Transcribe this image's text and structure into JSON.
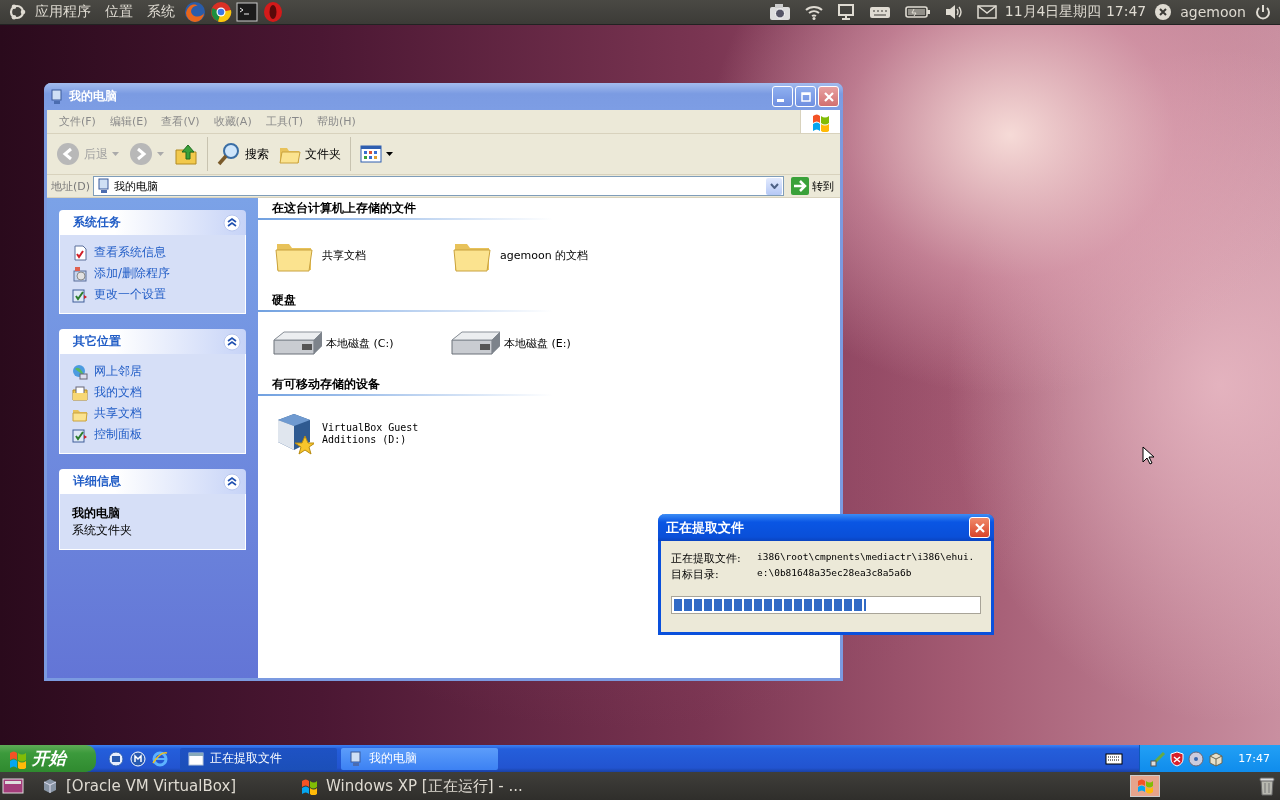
{
  "top_panel": {
    "menus": [
      "应用程序",
      "位置",
      "系统"
    ],
    "clock": "11月4日星期四 17:47",
    "user": "agemoon"
  },
  "explorer": {
    "title": "我的电脑",
    "menu": [
      "文件(F)",
      "编辑(E)",
      "查看(V)",
      "收藏(A)",
      "工具(T)",
      "帮助(H)"
    ],
    "toolbar": [
      {
        "kind": "back",
        "label": "后退",
        "disabled": true
      },
      {
        "kind": "forward",
        "disabled": true
      },
      {
        "kind": "up"
      },
      {
        "kind": "search",
        "label": "搜索"
      },
      {
        "kind": "folders",
        "label": "文件夹"
      },
      {
        "kind": "views"
      }
    ],
    "address": {
      "label": "地址(D)",
      "value": "我的电脑",
      "go": "转到"
    },
    "sidebar": [
      {
        "title": "系统任务",
        "expanded": true,
        "items": [
          {
            "kind": "info",
            "label": "查看系统信息"
          },
          {
            "kind": "programs",
            "label": "添加/删除程序"
          },
          {
            "kind": "settings",
            "label": "更改一个设置"
          }
        ]
      },
      {
        "title": "其它位置",
        "expanded": true,
        "items": [
          {
            "kind": "network",
            "label": "网上邻居"
          },
          {
            "kind": "documents",
            "label": "我的文档"
          },
          {
            "kind": "folder",
            "label": "共享文档"
          },
          {
            "kind": "settings",
            "label": "控制面板"
          }
        ]
      },
      {
        "title": "详细信息",
        "expanded": true,
        "details": {
          "name": "我的电脑",
          "description": "系统文件夹"
        }
      }
    ],
    "groups": [
      {
        "heading": "在这台计算机上存储的文件",
        "items": [
          {
            "kind": "folder",
            "label": "共享文档"
          },
          {
            "kind": "folder",
            "label": "agemoon 的文档"
          }
        ]
      },
      {
        "heading": "硬盘",
        "items": [
          {
            "kind": "drive",
            "label": "本地磁盘 (C:)"
          },
          {
            "kind": "drive",
            "label": "本地磁盘 (E:)"
          }
        ]
      },
      {
        "heading": "有可移动存储的设备",
        "items": [
          {
            "kind": "removable",
            "label": "VirtualBox Guest Additions (D:)"
          }
        ]
      }
    ]
  },
  "dialog": {
    "title": "正在提取文件",
    "rows": [
      {
        "label": "正在提取文件:",
        "value": "i386\\root\\cmpnents\\mediactr\\i386\\ehui."
      },
      {
        "label": "目标目录:",
        "value": "e:\\0b81648a35ec28ea3c8a5a6b"
      }
    ],
    "progress": {
      "level": 0.63
    }
  },
  "xp_taskbar": {
    "start": "开始",
    "tasks": [
      {
        "kind": "window",
        "label": "正在提取文件",
        "selected": true
      },
      {
        "kind": "computer",
        "label": "我的电脑",
        "selected": false
      }
    ],
    "clock": "17:47"
  },
  "bottom_panel": {
    "tasks": [
      {
        "kind": "cube",
        "label": "[Oracle VM VirtualBox]"
      },
      {
        "kind": "flag",
        "label": "Windows XP [正在运行] - ..."
      }
    ]
  }
}
